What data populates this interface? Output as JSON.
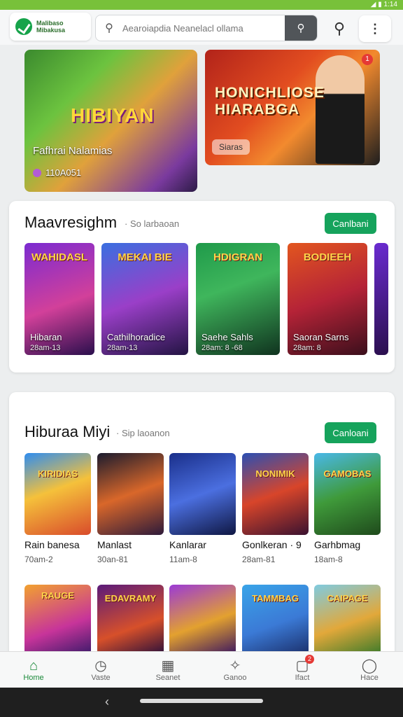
{
  "status_bar": {
    "icons": "◢ ▮ 1:14"
  },
  "header": {
    "logo_text": "Malibaso Mibakusa",
    "search_placeholder": "Aearoiapdia Neanelacl ollama",
    "search_icon": "search-icon",
    "menu_icon": "more-vertical-icon"
  },
  "hero": {
    "left": {
      "art_title": "HIBIYAN",
      "caption": "Fafhrai Nalamias",
      "subcaption": "110A051"
    },
    "right": {
      "art_title": "HONICHLIOSE HIARABGA",
      "tag": "Siaras",
      "badge": "1"
    }
  },
  "section1": {
    "title": "Maavresighm",
    "subtitle": "· So larbaoan",
    "button": "Canlbani",
    "cards": [
      {
        "art": "WAHIDASL",
        "title": "Hibaran",
        "meta": "28am-13"
      },
      {
        "art": "MEKAI BIE",
        "title": "Cathilhoradice",
        "meta": "28am-13"
      },
      {
        "art": "HDIGRAN",
        "title": "Saehe Sahls",
        "meta": "28am: 8 -68"
      },
      {
        "art": "BODIEEH",
        "title": "Saoran Sarns",
        "meta": "28am: 8"
      }
    ]
  },
  "section2": {
    "title": "Hiburaa Miyi",
    "subtitle": "· Sip laoanon",
    "button": "Canloani",
    "tiles_row1": [
      {
        "art": "KIRIDIAS",
        "name": "Rain banesa",
        "meta": "70am-2"
      },
      {
        "art": "",
        "name": "Manlast",
        "meta": "30an-81"
      },
      {
        "art": "",
        "name": "Kanlarar",
        "meta": "11am-8"
      },
      {
        "art": "NONIMIK",
        "name": "Gonlkeran · 9",
        "meta": "28am-81"
      },
      {
        "art": "GAMOBAS",
        "name": "Garhbmag",
        "meta": "18am-8"
      }
    ],
    "tiles_row2": [
      {
        "art": "RAUGE"
      },
      {
        "art": "EDAVRAMY"
      },
      {
        "art": ""
      },
      {
        "art": "TAMMBAG"
      },
      {
        "art": "CAIPAGE"
      }
    ]
  },
  "nav": [
    {
      "icon": "home-icon",
      "glyph": "⌂",
      "label": "Home",
      "active": true
    },
    {
      "icon": "clock-icon",
      "glyph": "◷",
      "label": "Vaste"
    },
    {
      "icon": "game-icon",
      "glyph": "▦",
      "label": "Seanet"
    },
    {
      "icon": "spark-icon",
      "glyph": "✧",
      "label": "Ganoo"
    },
    {
      "icon": "chat-icon",
      "glyph": "▢",
      "label": "Ifact",
      "badge": "2"
    },
    {
      "icon": "profile-icon",
      "glyph": "◯",
      "label": "Hace"
    }
  ]
}
